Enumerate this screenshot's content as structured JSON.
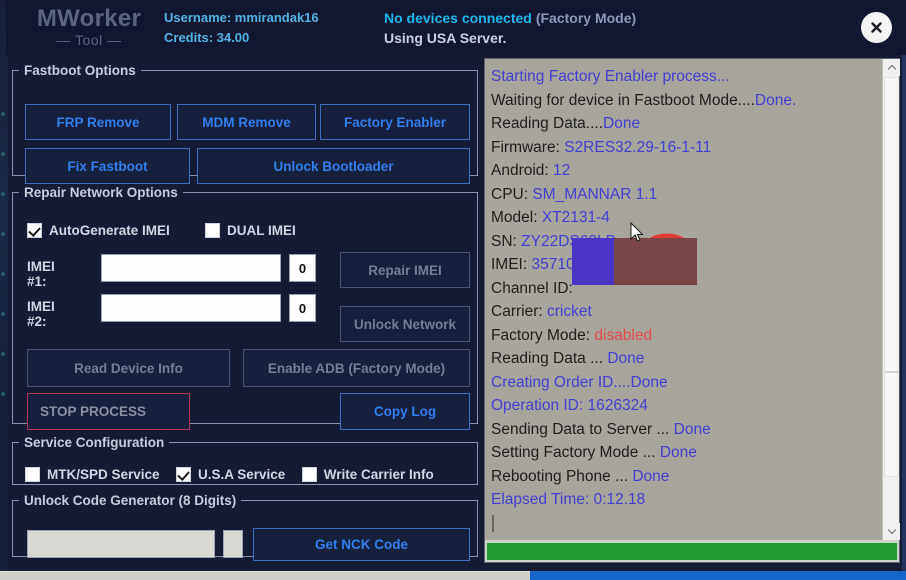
{
  "header": {
    "brand_main": "MWorker",
    "brand_sub": "— Tool —",
    "username": "Username: mmirandak16",
    "credits": "Credits: 34.00",
    "device_status_main": "No devices connected",
    "device_status_mode": "(Factory Mode)",
    "server_line": "Using USA Server.",
    "close_icon": "close-icon"
  },
  "fastboot": {
    "legend": "Fastboot Options",
    "frp_remove": "FRP Remove",
    "mdm_remove": "MDM Remove",
    "factory_enabler": "Factory Enabler",
    "fix_fastboot": "Fix Fastboot",
    "unlock_bootloader": "Unlock Bootloader"
  },
  "repair": {
    "legend": "Repair Network Options",
    "autogenerate_imei": "AutoGenerate IMEI",
    "autogenerate_imei_checked": true,
    "dual_imei": "DUAL IMEI",
    "dual_imei_checked": false,
    "imei1_label": "IMEI #1:",
    "imei1_value": "",
    "imei1_counter": "0",
    "imei2_label": "IMEI #2:",
    "imei2_value": "",
    "imei2_counter": "0",
    "repair_imei": "Repair IMEI",
    "unlock_network": "Unlock Network",
    "read_device_info": "Read Device Info",
    "enable_adb": "Enable ADB (Factory Mode)",
    "stop_process": "STOP PROCESS",
    "copy_log": "Copy Log"
  },
  "service": {
    "legend": "Service Configuration",
    "mtk_spd": "MTK/SPD Service",
    "mtk_spd_checked": false,
    "usa": "U.S.A Service",
    "usa_checked": true,
    "write_carrier": "Write Carrier Info",
    "write_carrier_checked": false
  },
  "unlock_gen": {
    "legend": "Unlock Code Generator (8 Digits)",
    "code_value": "",
    "extra_value": "",
    "get_nck_code": "Get NCK Code"
  },
  "log": {
    "lines": [
      {
        "text": "Starting Factory Enabler process...",
        "style": "all-blue"
      },
      {
        "label": "Waiting for device in Fastboot Mode....",
        "value": "Done."
      },
      {
        "label": "Reading Data....",
        "value": "Done"
      },
      {
        "label": "Firmware: ",
        "value": "S2RES32.29-16-1-11"
      },
      {
        "label": "Android: ",
        "value": "12"
      },
      {
        "label": "CPU: ",
        "value": "SM_MANNAR 1.1"
      },
      {
        "label": "Model: ",
        "value": "XT2131-4"
      },
      {
        "label": "SN: ",
        "value": "ZY22DS63LB"
      },
      {
        "label": "IMEI: ",
        "value": "35710"
      },
      {
        "label": "Channel ID: ",
        "value": ""
      },
      {
        "label": "Carrier: ",
        "value": "cricket"
      },
      {
        "label": "Factory Mode: ",
        "value": "disabled",
        "value_color": "red"
      },
      {
        "label": "Reading Data ... ",
        "value": "Done"
      },
      {
        "text": "Creating Order ID....Done",
        "style": "all-blue"
      },
      {
        "text": "Operation ID: 1626324",
        "style": "all-blue"
      },
      {
        "label": "Sending Data to Server ... ",
        "value": "Done"
      },
      {
        "label": "Setting Factory Mode ... ",
        "value": "Done"
      },
      {
        "label": "Rebooting Phone ... ",
        "value": "Done"
      },
      {
        "text": "Elapsed Time: 0:12.18",
        "style": "all-blue"
      }
    ],
    "scrollbar_up": "chevron-up-icon",
    "scrollbar_down": "chevron-down-icon",
    "progress_percent": 100
  },
  "colors": {
    "accent_blue": "#2f7ff0",
    "status_cyan": "#19b7f0",
    "log_value_blue": "#4040cf",
    "log_value_red": "#e24b4b",
    "progress_green": "#1f9b2e",
    "danger_red": "#b03a54"
  }
}
